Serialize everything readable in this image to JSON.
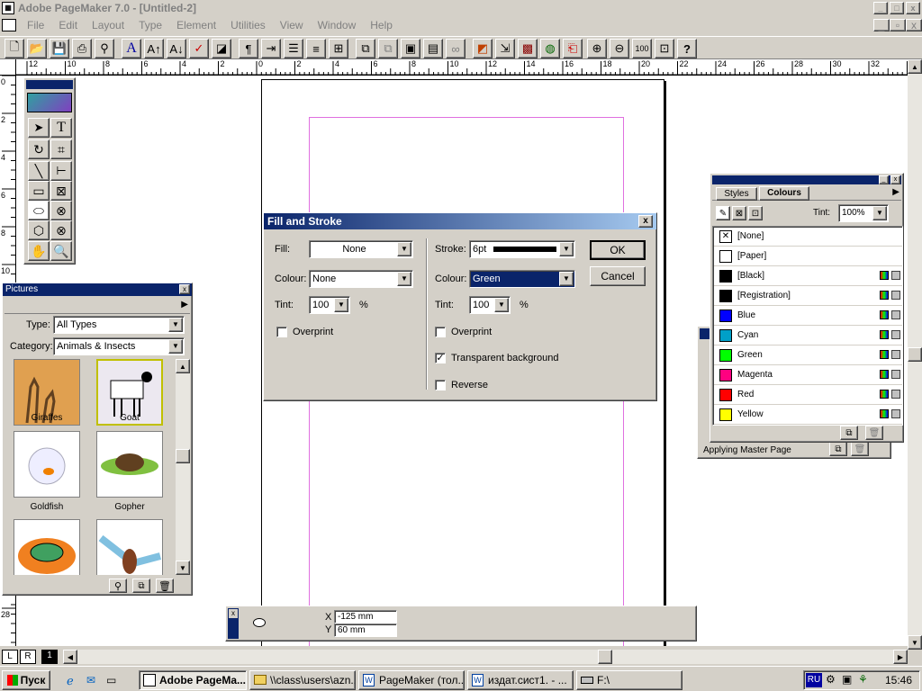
{
  "app": {
    "title": "Adobe PageMaker 7.0 - [Untitled-2]",
    "min": "_",
    "max": "□",
    "close": "x"
  },
  "menu": [
    "File",
    "Edit",
    "Layout",
    "Type",
    "Element",
    "Utilities",
    "View",
    "Window",
    "Help"
  ],
  "ruler": {
    "h_labels": [
      "12",
      "10",
      "8",
      "6",
      "4",
      "2",
      "0",
      "2",
      "4",
      "6",
      "8",
      "10",
      "12",
      "14",
      "16",
      "18",
      "20",
      "22",
      "24",
      "26",
      "28",
      "30",
      "32",
      "34"
    ],
    "v_labels": [
      "0",
      "2",
      "4",
      "6",
      "8",
      "10",
      "28"
    ]
  },
  "pictures_panel": {
    "title": "Pictures",
    "type_label": "Type:",
    "type_value": "All Types",
    "category_label": "Category:",
    "category_value": "Animals & Insects",
    "items": [
      {
        "label": "Giraffes"
      },
      {
        "label": "Goat"
      },
      {
        "label": "Goldfish"
      },
      {
        "label": "Gopher"
      },
      {
        "label": ""
      },
      {
        "label": ""
      }
    ]
  },
  "dialog": {
    "title": "Fill and Stroke",
    "fill_label": "Fill:",
    "fill_value": "None",
    "colour_label": "Colour:",
    "fill_colour_value": "None",
    "tint_label": "Tint:",
    "fill_tint_value": "100",
    "percent": "%",
    "overprint_label": "Overprint",
    "stroke_label": "Stroke:",
    "stroke_value": "6pt",
    "stroke_colour_value": "Green",
    "stroke_tint_value": "100",
    "stroke_overprint_label": "Overprint",
    "transparent_label": "Transparent background",
    "transparent_checked": true,
    "reverse_label": "Reverse",
    "ok_label": "OK",
    "cancel_label": "Cancel"
  },
  "colours_panel": {
    "tabs": [
      "Styles",
      "Colours"
    ],
    "tint_label": "Tint:",
    "tint_value": "100%",
    "colours": [
      {
        "name": "[None]",
        "color": "#ffffff"
      },
      {
        "name": "[Paper]",
        "color": "#ffffff"
      },
      {
        "name": "[Black]",
        "color": "#000000"
      },
      {
        "name": "[Registration]",
        "color": "#000000"
      },
      {
        "name": "Blue",
        "color": "#0000ff"
      },
      {
        "name": "Cyan",
        "color": "#00a0c8"
      },
      {
        "name": "Green",
        "color": "#00ff00"
      },
      {
        "name": "Magenta",
        "color": "#ff0080"
      },
      {
        "name": "Red",
        "color": "#ff0000"
      },
      {
        "name": "Yellow",
        "color": "#ffff00"
      }
    ],
    "behind_label": "Applying Master Page"
  },
  "control_palette": {
    "x_label": "X",
    "x_value": "-125 mm",
    "y_label": "Y",
    "y_value": "60 mm"
  },
  "pages": {
    "left": "L",
    "right": "R",
    "page1": "1"
  },
  "taskbar": {
    "start": "Пуск",
    "tasks": [
      "Adobe PageMa...",
      "\\\\class\\users\\azn...",
      "PageMaker (тол...",
      "издат.сист1. - ...",
      "F:\\"
    ],
    "lang": "RU",
    "clock": "15:46"
  }
}
